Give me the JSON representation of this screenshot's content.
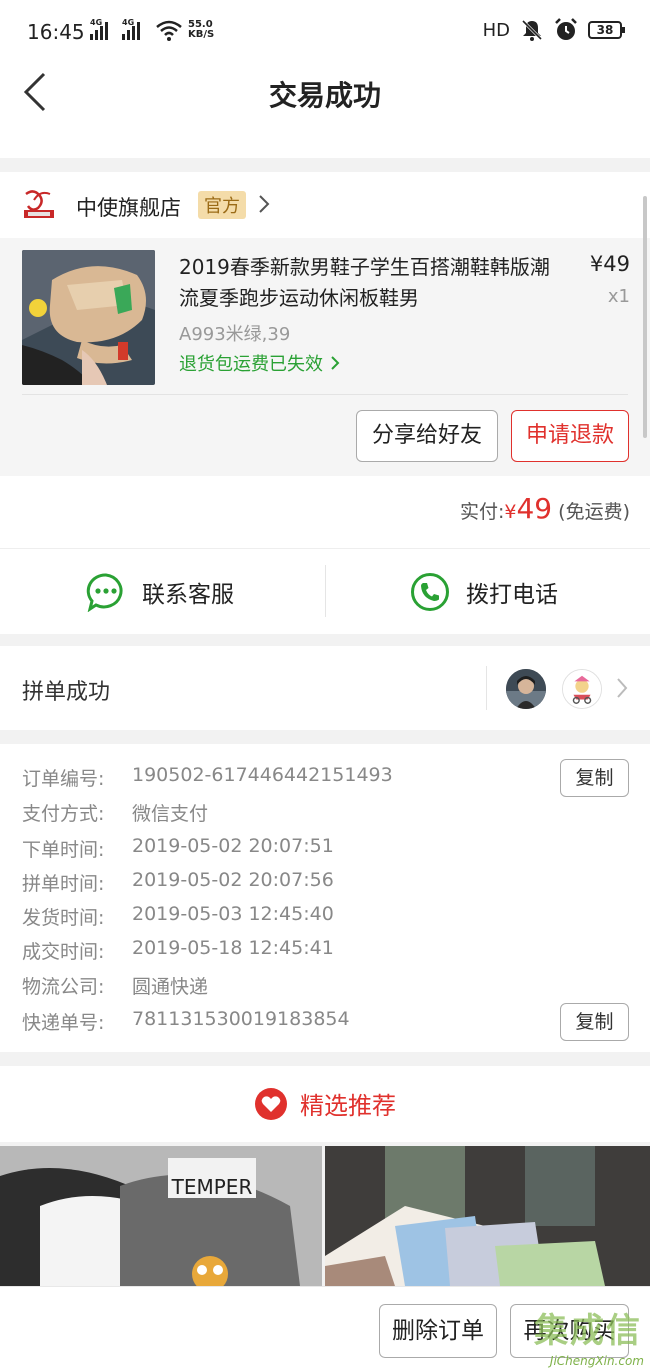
{
  "status_bar": {
    "time": "16:45",
    "signal_1": "4G",
    "signal_2": "4G",
    "net_speed_value": "55.0",
    "net_speed_unit": "KB/S",
    "hd": "HD",
    "battery": "38",
    "icons": [
      "signal-icon",
      "wifi-icon",
      "mute-icon",
      "alarm-icon",
      "battery-icon"
    ]
  },
  "nav": {
    "title": "交易成功",
    "back_icon": "back-arrow-icon"
  },
  "shop": {
    "name": "中使旗舰店",
    "badge": "官方"
  },
  "product": {
    "title": "2019春季新款男鞋子学生百搭潮鞋韩版潮流夏季跑步运动休闲板鞋男",
    "price": "¥49",
    "quantity": "x1",
    "spec": "A993米绿,39",
    "return_note": "退货包运费已失效"
  },
  "actions": {
    "share": "分享给好友",
    "refund": "申请退款"
  },
  "payment": {
    "label": "实付:",
    "currency": "¥",
    "amount": "49",
    "shipping_note": "(免运费)"
  },
  "contact": {
    "customer_service": "联系客服",
    "phone": "拨打电话"
  },
  "group": {
    "label": "拼单成功"
  },
  "order_info": {
    "rows": [
      {
        "key": "订单编号:",
        "value": "190502-617446442151493"
      },
      {
        "key": "支付方式:",
        "value": "微信支付"
      },
      {
        "key": "下单时间:",
        "value": "2019-05-02 20:07:51"
      },
      {
        "key": "拼单时间:",
        "value": "2019-05-02 20:07:56"
      },
      {
        "key": "发货时间:",
        "value": "2019-05-03 12:45:40"
      },
      {
        "key": "成交时间:",
        "value": "2019-05-18 12:45:41"
      },
      {
        "key": "物流公司:",
        "value": "圆通快递"
      },
      {
        "key": "快递单号:",
        "value": "781131530019183854"
      }
    ],
    "copy_label": "复制"
  },
  "recommend": {
    "title": "精选推荐",
    "tee_print": "TEMPER"
  },
  "bottom": {
    "delete": "删除订单",
    "rebuy": "再次购买"
  },
  "watermark": {
    "big": "集成信",
    "url": "JiChengXin.com"
  },
  "colors": {
    "accent_red": "#e0312d",
    "green": "#2aa134",
    "badge_bg": "#f4dca9"
  }
}
